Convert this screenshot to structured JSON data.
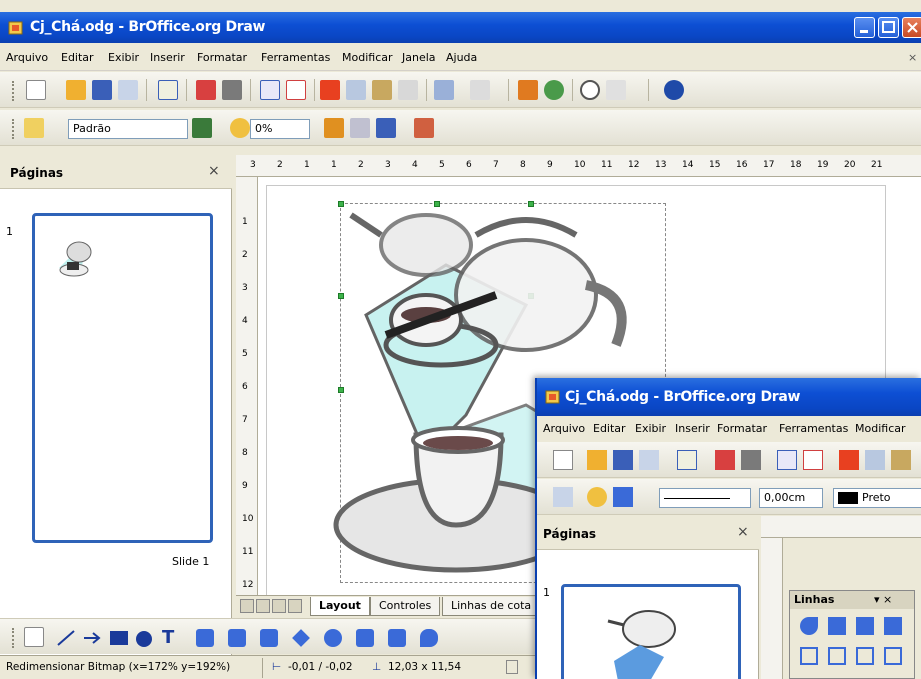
{
  "window": {
    "title": "Cj_Chá.odg - BrOffice.org Draw"
  },
  "menu": [
    "Arquivo",
    "Editar",
    "Exibir",
    "Inserir",
    "Formatar",
    "Ferramentas",
    "Modificar",
    "Janela",
    "Ajuda"
  ],
  "format_bar": {
    "style_value": "Padrão",
    "transparency_value": "0%"
  },
  "pages_panel": {
    "title": "Páginas",
    "close": "×",
    "slide_number": "1",
    "slide_label": "Slide 1"
  },
  "ruler": {
    "h_labels": [
      "3",
      "2",
      "1",
      "1",
      "2",
      "3",
      "4",
      "5",
      "6",
      "7",
      "8",
      "9",
      "10",
      "11",
      "12",
      "13",
      "14",
      "15",
      "16",
      "17",
      "18",
      "19",
      "20",
      "21"
    ],
    "v_labels": [
      "1",
      "2",
      "3",
      "4",
      "5",
      "6",
      "7",
      "8",
      "9",
      "10",
      "11",
      "12"
    ]
  },
  "tabs": {
    "layout": "Layout",
    "controls": "Controles",
    "dimension_lines": "Linhas de cota"
  },
  "status": {
    "action": "Redimensionar Bitmap (x=172% y=192%)",
    "position": "-0,01 / -0,02",
    "size": "12,03 x 11,54"
  },
  "window2": {
    "title": "Cj_Chá.odg - BrOffice.org Draw",
    "menu": [
      "Arquivo",
      "Editar",
      "Exibir",
      "Inserir",
      "Formatar",
      "Ferramentas",
      "Modificar"
    ],
    "line_width": "0,00cm",
    "line_color": "Preto",
    "panel_title": "Páginas",
    "panel_close": "×",
    "slide_number": "1",
    "lines_toolbar_title": "Linhas",
    "lines_toolbar_controls": "▾ ×"
  },
  "colors": {
    "title_blue": "#0a46c4",
    "slide_border": "#2f63b8",
    "teapot_cyan": "#bff0ee",
    "handle_green": "#3db34a"
  }
}
